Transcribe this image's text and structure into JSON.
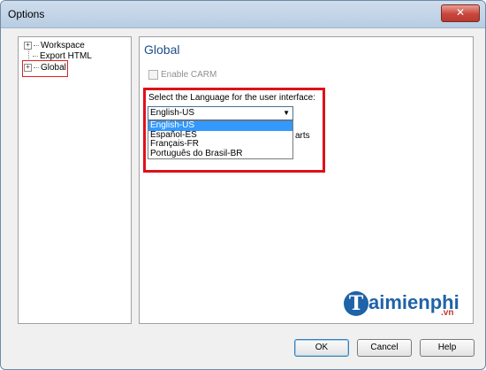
{
  "window": {
    "title": "Options",
    "close_glyph": "✕"
  },
  "tree": {
    "items": [
      {
        "label": "Workspace",
        "expander": "+"
      },
      {
        "label": "Export HTML"
      },
      {
        "label": "Global",
        "expander": "+"
      }
    ]
  },
  "panel": {
    "heading": "Global",
    "enable_carm_label": "Enable CARM",
    "language_label": "Select the Language for the user interface:",
    "selected_language": "English-US",
    "languages": [
      "English-US",
      "Español-ES",
      "Français-FR",
      "Português do Brasil-BR"
    ],
    "hidden_text_peek": "arts"
  },
  "watermark": {
    "logo_text": "aimienphi",
    "logo_letter": "T",
    "logo_suffix": ".vn"
  },
  "buttons": {
    "ok": "OK",
    "cancel": "Cancel",
    "help": "Help"
  },
  "colors": {
    "accent": "#1e4e8c",
    "highlight_box": "#e0101a",
    "selection": "#3399ff"
  },
  "icons": {
    "close": "close-icon",
    "expander": "plus-box-icon",
    "dropdown": "chevron-down-icon"
  }
}
